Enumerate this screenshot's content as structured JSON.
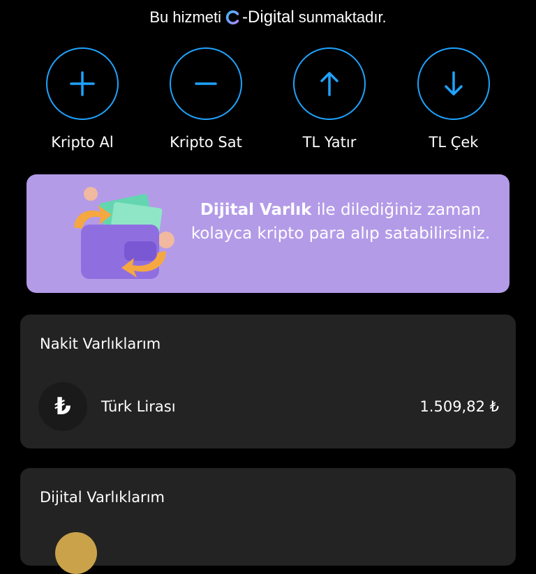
{
  "banner": {
    "prefix": "Bu hizmeti",
    "brand": "-Digital",
    "suffix": "sunmaktadır."
  },
  "actions": [
    {
      "label": "Kripto Al",
      "icon": "plus-icon"
    },
    {
      "label": "Kripto Sat",
      "icon": "minus-icon"
    },
    {
      "label": "TL Yatır",
      "icon": "arrow-up-icon"
    },
    {
      "label": "TL Çek",
      "icon": "arrow-down-icon"
    }
  ],
  "promo": {
    "strong": "Dijital Varlık",
    "text": " ile dilediğiniz zaman kolayca kripto para alıp satabilirsiniz."
  },
  "cash_assets": {
    "title": "Nakit Varlıklarım",
    "items": [
      {
        "icon": "₺",
        "name": "Türk Lirası",
        "value": "1.509,82 ₺"
      }
    ]
  },
  "digital_assets": {
    "title": "Dijital Varlıklarım"
  },
  "colors": {
    "accent": "#1fa3ff",
    "promo_bg": "#b39be8",
    "card_bg": "#232323"
  }
}
